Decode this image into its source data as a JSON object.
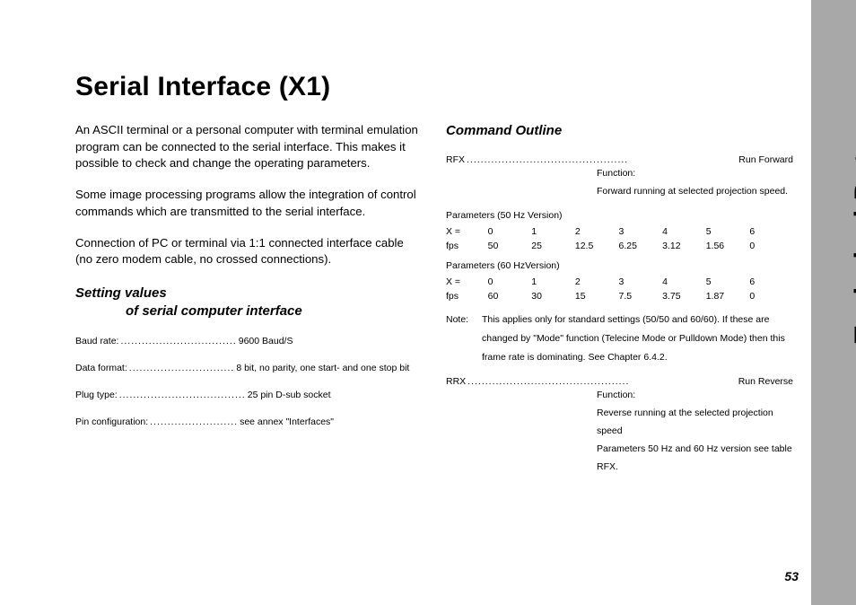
{
  "sidebar_label": "Technical Data",
  "page_number": "53",
  "title": "Serial Interface (X1)",
  "left": {
    "p1": "An ASCII terminal or a personal computer with terminal emulation program can be connected to the serial interface. This makes it possible to check and change the operating parameters.",
    "p2": "Some image processing programs allow the integration of control commands which are transmitted to the serial interface.",
    "p3": "Connection of PC or terminal via 1:1 connected interface cable (no zero modem cable, no crossed connections).",
    "subhead_l1": "Setting values",
    "subhead_l2": "of serial computer interface",
    "specs": {
      "baud_label": "Baud rate:",
      "baud_val": "9600 Baud/S",
      "format_label": "Data format:",
      "format_val": "8 bit, no parity, one start- and one stop bit",
      "plug_label": "Plug type:",
      "plug_val": "25 pin D-sub socket",
      "pin_label": "Pin configuration:",
      "pin_val": "see annex \"Interfaces\""
    }
  },
  "right": {
    "subhead": "Command Outline",
    "rfx": {
      "name": "RFX",
      "value": "Run Forward",
      "func_label": "Function:",
      "func_text": "Forward running at selected projection speed."
    },
    "params50": {
      "caption": "Parameters (50 Hz Version)",
      "row1": [
        "X =",
        "0",
        "1",
        "2",
        "3",
        "4",
        "5",
        "6"
      ],
      "row2": [
        "fps",
        "50",
        "25",
        "12.5",
        "6.25",
        "3.12",
        "1.56",
        "0"
      ]
    },
    "params60": {
      "caption": "Parameters (60 HzVersion)",
      "row1": [
        "X =",
        "0",
        "1",
        "2",
        "3",
        "4",
        "5",
        "6"
      ],
      "row2": [
        "fps",
        "60",
        "30",
        "15",
        "7.5",
        "3.75",
        "1.87",
        "0"
      ]
    },
    "note_label": "Note:",
    "note_body": "This applies only for standard settings (50/50 and 60/60). If these are changed by \"Mode\" function (Telecine Mode or Pulldown Mode) then this frame rate is dominating. See Chapter 6.4.2.",
    "rrx": {
      "name": "RRX",
      "value": "Run Reverse",
      "func_label": "Function:",
      "func_text1": "Reverse running at the selected projection",
      "func_text2": "speed",
      "func_text3": "Parameters 50 Hz and 60 Hz version see table",
      "func_text4": "RFX."
    }
  },
  "chart_data": [
    {
      "type": "table",
      "title": "Parameters (50 Hz Version)",
      "columns": [
        "X",
        "fps"
      ],
      "rows": [
        {
          "X": 0,
          "fps": 50
        },
        {
          "X": 1,
          "fps": 25
        },
        {
          "X": 2,
          "fps": 12.5
        },
        {
          "X": 3,
          "fps": 6.25
        },
        {
          "X": 4,
          "fps": 3.12
        },
        {
          "X": 5,
          "fps": 1.56
        },
        {
          "X": 6,
          "fps": 0
        }
      ]
    },
    {
      "type": "table",
      "title": "Parameters (60 Hz Version)",
      "columns": [
        "X",
        "fps"
      ],
      "rows": [
        {
          "X": 0,
          "fps": 60
        },
        {
          "X": 1,
          "fps": 30
        },
        {
          "X": 2,
          "fps": 15
        },
        {
          "X": 3,
          "fps": 7.5
        },
        {
          "X": 4,
          "fps": 3.75
        },
        {
          "X": 5,
          "fps": 1.87
        },
        {
          "X": 6,
          "fps": 0
        }
      ]
    }
  ]
}
